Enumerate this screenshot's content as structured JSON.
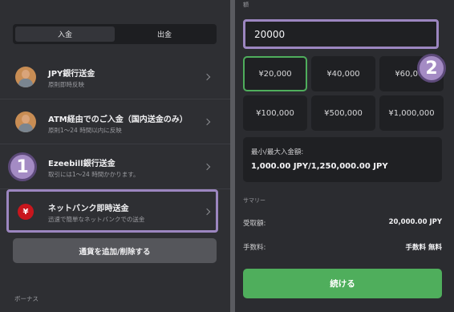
{
  "tabs": {
    "deposit": "入金",
    "withdraw": "出金"
  },
  "methods": [
    {
      "title": "JPY銀行送金",
      "sub": "原則即時反映"
    },
    {
      "title": "ATM経由でのご入金（国内送金のみ）",
      "sub": "原則1〜24 時間以内に反映"
    },
    {
      "title": "Ezeebill銀行送金",
      "sub": "取引には1〜24 時間かかります。"
    },
    {
      "title": "ネットバンク即時送金",
      "sub": "迅速で簡単なネットバンクでの送金",
      "icon_glyph": "¥"
    }
  ],
  "add_currency_button": "通貨を追加/削除する",
  "bonus_label": "ボーナス",
  "markers": {
    "one": "1",
    "two": "2"
  },
  "right": {
    "amount_label": "額",
    "amount_value": "20000",
    "presets": [
      "¥20,000",
      "¥40,000",
      "¥60,000",
      "¥100,000",
      "¥500,000",
      "¥1,000,000"
    ],
    "limits_label": "最小/最大入金額:",
    "limits_value": "1,000.00 JPY/1,250,000.00 JPY",
    "summary_label": "サマリー",
    "received_label": "受取額:",
    "received_value": "20,000.00 JPY",
    "fee_label": "手数料:",
    "fee_value": "手数料 無料",
    "continue_button": "続ける"
  },
  "colors": {
    "accent_green": "#4fae5c",
    "highlight_purple": "#9c86c0",
    "yen_red": "#c8161d"
  }
}
